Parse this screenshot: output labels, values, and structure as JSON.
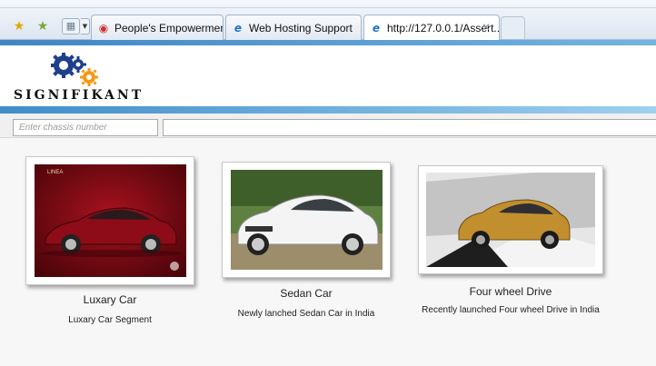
{
  "browser": {
    "tabs": [
      {
        "label": "People's Empowerment N...",
        "icon": "red-circle-favicon-icon"
      },
      {
        "label": "Web Hosting Support",
        "icon": "ie-favicon-icon"
      },
      {
        "label": "http://127.0.0.1/Assert...",
        "icon": "ie-favicon-icon",
        "active": true
      }
    ],
    "close_glyph": "✕"
  },
  "logo": {
    "text": "SIGNIFIKANT",
    "colors": {
      "gear_blue": "#1f3f8a",
      "gear_orange": "#f29a1a"
    }
  },
  "search": {
    "chassis_placeholder": "Enter chassis number"
  },
  "cars": [
    {
      "title": "Luxary Car",
      "description": "Luxary Car Segment",
      "badge": "LINEA",
      "photo_colors": {
        "bg": "#7a0b12",
        "car": "#a0101d"
      }
    },
    {
      "title": "Sedan Car",
      "description": "Newly lanched Sedan Car in India",
      "photo_colors": {
        "bg": "#6b8f4a",
        "car": "#f4f4f4"
      }
    },
    {
      "title": "Four wheel Drive",
      "description": "Recently launched Four wheel Drive in India",
      "photo_colors": {
        "bg": "#cfcfcf",
        "car": "#c79a3a"
      }
    }
  ],
  "colors": {
    "accent_blue": "#3e86c3",
    "content_bg": "#f7f7f7"
  }
}
